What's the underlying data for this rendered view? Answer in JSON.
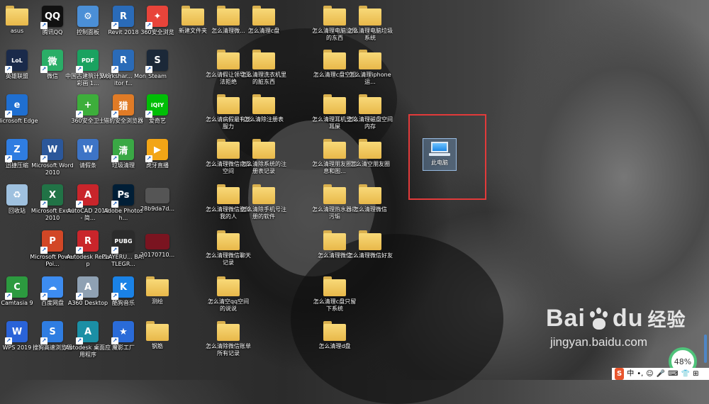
{
  "desktop": {
    "icons": [
      {
        "label": "asus",
        "kind": "folder",
        "color": "#f0c75e",
        "glyph": "",
        "shortcut": false
      },
      {
        "label": "英雄联盟",
        "kind": "app",
        "color": "#1a2a4a",
        "glyph": "LoL",
        "shortcut": true
      },
      {
        "label": "Microsoft Edge",
        "kind": "app",
        "color": "#1f6fd1",
        "glyph": "e",
        "shortcut": true
      },
      {
        "label": "迅捷压缩",
        "kind": "app",
        "color": "#2f7de1",
        "glyph": "Z",
        "shortcut": true
      },
      {
        "label": "回收站",
        "kind": "app",
        "color": "#9fc1df",
        "glyph": "♻",
        "shortcut": false
      },
      {
        "label": "Microsoft PowerPoi...",
        "kind": "app",
        "color": "#d24726",
        "glyph": "P",
        "shortcut": true
      },
      {
        "label": "Camtasia 9",
        "kind": "app",
        "color": "#2c9a3f",
        "glyph": "C",
        "shortcut": true
      },
      {
        "label": "WPS 2019",
        "kind": "app",
        "color": "#2a63d8",
        "glyph": "W",
        "shortcut": true
      },
      {
        "label": "腾讯QQ",
        "kind": "app",
        "color": "#111111",
        "glyph": "QQ",
        "shortcut": true
      },
      {
        "label": "微信",
        "kind": "app",
        "color": "#2aae67",
        "glyph": "微",
        "shortcut": true
      },
      {
        "label": "360安全卫士",
        "kind": "app",
        "color": "#3dae3b",
        "glyph": "+",
        "shortcut": true
      },
      {
        "label": "Microsoft Word 2010",
        "kind": "app",
        "color": "#2b579a",
        "glyph": "W",
        "shortcut": true
      },
      {
        "label": "Microsoft Excel 2010",
        "kind": "app",
        "color": "#217346",
        "glyph": "X",
        "shortcut": true
      },
      {
        "label": "Microsoft PowerPoi...",
        "kind": "app",
        "color": "#d24726",
        "glyph": "P",
        "shortcut": true
      },
      {
        "label": "百度网盘",
        "kind": "app",
        "color": "#3d8cf0",
        "glyph": "☁",
        "shortcut": true
      },
      {
        "label": "搜狗高速浏览器",
        "kind": "app",
        "color": "#2f7de1",
        "glyph": "S",
        "shortcut": true
      },
      {
        "label": "控制面板",
        "kind": "app",
        "color": "#4b8fd6",
        "glyph": "⚙",
        "shortcut": false
      },
      {
        "label": "中国古建筑计算机彩画 1...",
        "kind": "app",
        "color": "#1aa260",
        "glyph": "PDF",
        "shortcut": true
      },
      {
        "label": "猎豹安全浏览器",
        "kind": "app",
        "color": "#e07b26",
        "glyph": "猎",
        "shortcut": true
      },
      {
        "label": "请假条",
        "kind": "app",
        "color": "#3d74c6",
        "glyph": "W",
        "shortcut": false
      },
      {
        "label": "AutoCAD 2018 - 简...",
        "kind": "app",
        "color": "#c9252b",
        "glyph": "A",
        "shortcut": true
      },
      {
        "label": "Autodesk ReCap",
        "kind": "app",
        "color": "#c9252b",
        "glyph": "R",
        "shortcut": true
      },
      {
        "label": "A360 Desktop",
        "kind": "app",
        "color": "#8fa1b3",
        "glyph": "A",
        "shortcut": true
      },
      {
        "label": "Autodesk 桌面应用程序",
        "kind": "app",
        "color": "#1b8fa5",
        "glyph": "A",
        "shortcut": true
      },
      {
        "label": "Revit 2018",
        "kind": "app",
        "color": "#2a6bb8",
        "glyph": "R",
        "shortcut": true
      },
      {
        "label": "Workshar... Monitor f...",
        "kind": "app",
        "color": "#2a6bb8",
        "glyph": "R",
        "shortcut": true
      },
      {
        "label": "垃圾清理",
        "kind": "app",
        "color": "#3aa845",
        "glyph": "清",
        "shortcut": true
      },
      {
        "label": "Adobe Photosh...",
        "kind": "app",
        "color": "#001e36",
        "glyph": "Ps",
        "shortcut": true
      },
      {
        "label": "PLAYERU... BATTLEGR...",
        "kind": "app",
        "color": "#2b2b2b",
        "glyph": "PUBG",
        "shortcut": true
      },
      {
        "label": "酷狗音乐",
        "kind": "app",
        "color": "#1a82e6",
        "glyph": "K",
        "shortcut": true
      },
      {
        "label": "魔影工厂",
        "kind": "app",
        "color": "#2a6bd8",
        "glyph": "★",
        "shortcut": true
      },
      {
        "label": "360安全浏览",
        "kind": "app",
        "color": "#e8443a",
        "glyph": "✦",
        "shortcut": true
      },
      {
        "label": "Steam",
        "kind": "app",
        "color": "#1b2838",
        "glyph": "S",
        "shortcut": true
      },
      {
        "label": "爱奇艺",
        "kind": "app",
        "color": "#00be06",
        "glyph": "iQIY",
        "shortcut": true
      },
      {
        "label": "虎牙直播",
        "kind": "app",
        "color": "#f2a516",
        "glyph": "▶",
        "shortcut": true
      },
      {
        "label": "28b9da7d...",
        "kind": "image",
        "color": "#555555",
        "glyph": "",
        "shortcut": false
      },
      {
        "label": "20170710...",
        "kind": "image",
        "color": "#7a1420",
        "glyph": "",
        "shortcut": false
      },
      {
        "label": "测绘",
        "kind": "folder",
        "color": "#f0c75e",
        "glyph": "",
        "shortcut": false
      },
      {
        "label": "钢筋",
        "kind": "folder",
        "color": "#f0c75e",
        "glyph": "",
        "shortcut": false
      },
      {
        "label": "新建文件夹",
        "kind": "folder",
        "color": "#f0c75e",
        "glyph": "",
        "shortcut": false
      },
      {
        "label": "怎么清理微...",
        "kind": "folder",
        "color": "#f0c75e",
        "glyph": "",
        "shortcut": false
      },
      {
        "label": "怎么请假让领导无法拒绝",
        "kind": "folder",
        "color": "#f0c75e",
        "glyph": "",
        "shortcut": false
      },
      {
        "label": "怎么请病假最有说服力",
        "kind": "folder",
        "color": "#f0c75e",
        "glyph": "",
        "shortcut": false
      },
      {
        "label": "怎么清理微信内存空间",
        "kind": "folder",
        "color": "#f0c75e",
        "glyph": "",
        "shortcut": false
      },
      {
        "label": "怎么清理微信删除我的人",
        "kind": "folder",
        "color": "#f0c75e",
        "glyph": "",
        "shortcut": false
      },
      {
        "label": "怎么清理微信聊天记录",
        "kind": "folder",
        "color": "#f0c75e",
        "glyph": "",
        "shortcut": false
      },
      {
        "label": "怎么清空qq空间的说说",
        "kind": "folder",
        "color": "#f0c75e",
        "glyph": "",
        "shortcut": false
      },
      {
        "label": "怎么清除微信账单所有记录",
        "kind": "folder",
        "color": "#f0c75e",
        "glyph": "",
        "shortcut": false
      },
      {
        "label": "怎么清理c盘",
        "kind": "folder",
        "color": "#f0c75e",
        "glyph": "",
        "shortcut": false
      },
      {
        "label": "怎么清理洗衣机里的脏东西",
        "kind": "folder",
        "color": "#f0c75e",
        "glyph": "",
        "shortcut": false
      },
      {
        "label": "怎么清除注册表",
        "kind": "folder",
        "color": "#f0c75e",
        "glyph": "",
        "shortcut": false
      },
      {
        "label": "怎么清除系统的注册表记录",
        "kind": "folder",
        "color": "#f0c75e",
        "glyph": "",
        "shortcut": false
      },
      {
        "label": "怎么清除手机号注册的软件",
        "kind": "folder",
        "color": "#f0c75e",
        "glyph": "",
        "shortcut": false
      },
      {
        "label": "怎么清理电脑没用的东西",
        "kind": "folder",
        "color": "#f0c75e",
        "glyph": "",
        "shortcut": false
      },
      {
        "label": "怎么清理c盘空间",
        "kind": "folder",
        "color": "#f0c75e",
        "glyph": "",
        "shortcut": false
      },
      {
        "label": "怎么清理耳机里的耳屎",
        "kind": "folder",
        "color": "#f0c75e",
        "glyph": "",
        "shortcut": false
      },
      {
        "label": "怎么清理朋友圈信息和图...",
        "kind": "folder",
        "color": "#f0c75e",
        "glyph": "",
        "shortcut": false
      },
      {
        "label": "怎么清理热水器的污垢",
        "kind": "folder",
        "color": "#f0c75e",
        "glyph": "",
        "shortcut": false
      },
      {
        "label": "怎么清理微信",
        "kind": "folder",
        "color": "#f0c75e",
        "glyph": "",
        "shortcut": false
      },
      {
        "label": "怎么清理c盘只留下系统",
        "kind": "folder",
        "color": "#f0c75e",
        "glyph": "",
        "shortcut": false
      },
      {
        "label": "怎么清理d盘",
        "kind": "folder",
        "color": "#f0c75e",
        "glyph": "",
        "shortcut": false
      },
      {
        "label": "怎么清理电脑垃圾系统",
        "kind": "folder",
        "color": "#f0c75e",
        "glyph": "",
        "shortcut": false
      },
      {
        "label": "怎么清理iphone运...",
        "kind": "folder",
        "color": "#f0c75e",
        "glyph": "",
        "shortcut": false
      },
      {
        "label": "怎么清理磁盘空间内存",
        "kind": "folder",
        "color": "#f0c75e",
        "glyph": "",
        "shortcut": false
      },
      {
        "label": "怎么清空朋友圈",
        "kind": "folder",
        "color": "#f0c75e",
        "glyph": "",
        "shortcut": false
      },
      {
        "label": "怎么清理微信",
        "kind": "folder",
        "color": "#f0c75e",
        "glyph": "",
        "shortcut": false
      },
      {
        "label": "怎么清理微信好友",
        "kind": "folder",
        "color": "#f0c75e",
        "glyph": "",
        "shortcut": false
      }
    ],
    "selected_icon": {
      "label": "此电脑"
    }
  },
  "watermark": {
    "brand": "Bai",
    "brand_suffix": "du",
    "cn": "经验",
    "url": "jingyan.baidu.com"
  },
  "speed_ball": {
    "value": "48%"
  },
  "ime": {
    "logo": "S",
    "mode": "中",
    "items": [
      "•,",
      "☺",
      "🎤",
      "⌨",
      "👕",
      "⊞"
    ]
  }
}
